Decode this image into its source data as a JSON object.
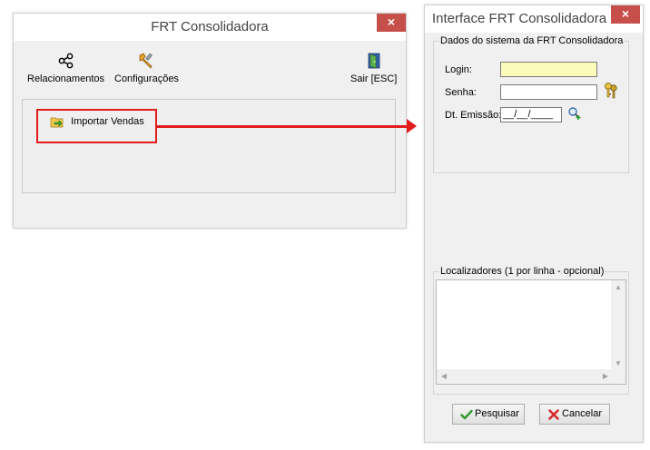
{
  "main_window": {
    "title": "FRT Consolidadora",
    "close_label": "×",
    "toolbar": {
      "relacionamentos": "Relacionamentos",
      "configuracoes": "Configurações",
      "sair": "Sair [ESC]"
    },
    "importar_vendas": "Importar Vendas"
  },
  "interface_window": {
    "title": "Interface FRT Consolidadora",
    "close_label": "×",
    "group_dados": "Dados do sistema da FRT Consolidadora",
    "login_label": "Login:",
    "login_value": "",
    "senha_label": "Senha:",
    "senha_value": "",
    "dt_emissao_label": "Dt. Emissão:",
    "dt_emissao_value": "__/__/____",
    "group_localizadores": "Localizadores (1 por linha - opcional)",
    "localizadores_value": "",
    "pesquisar_label": "Pesquisar",
    "cancelar_label": "Cancelar"
  },
  "icons": {
    "relacionamentos": "share-icon",
    "configuracoes": "wrench-icon",
    "sair": "exit-door-icon",
    "importar": "folder-import-icon",
    "senha": "keys-icon",
    "dt_emissao": "search-add-icon",
    "pesquisar": "check-icon",
    "cancelar": "x-icon"
  },
  "colors": {
    "close_button": "#c74f4a",
    "highlight": "#e41b1b",
    "login_field": "#fbfcb9"
  }
}
